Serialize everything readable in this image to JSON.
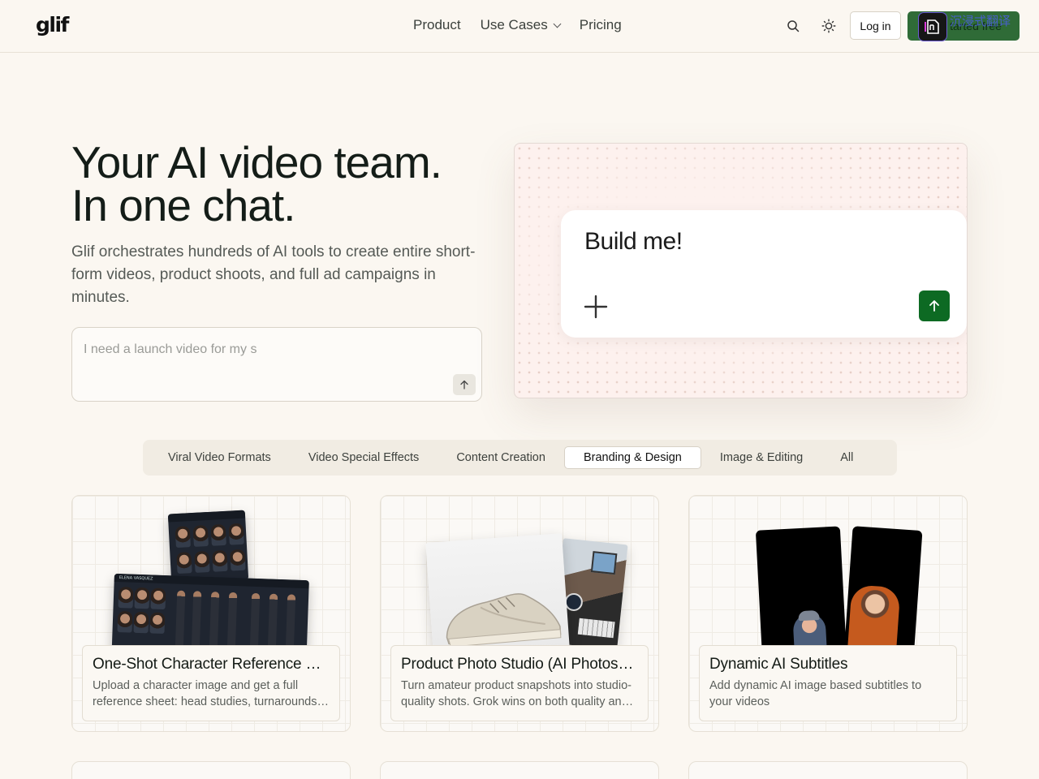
{
  "header": {
    "logo": "glif",
    "nav": [
      {
        "label": "Product"
      },
      {
        "label": "Use Cases",
        "has_dropdown": true
      },
      {
        "label": "Pricing"
      }
    ],
    "search_icon": "search-icon",
    "theme_icon": "sun-icon",
    "login_label": "Log in",
    "start_label": "tarted free",
    "overlay_text": "沉浸式翻译"
  },
  "hero": {
    "title_line1": "Your AI video team.",
    "title_line2": "In one chat.",
    "subtitle": "Glif orchestrates hundreds of AI tools to create entire short-form videos, product shoots, and full ad campaigns in minutes.",
    "prompt_placeholder": "I need a launch video for my s"
  },
  "demo": {
    "text": "Build me!"
  },
  "tabs": {
    "items": [
      {
        "label": "Viral Video Formats"
      },
      {
        "label": "Video Special Effects"
      },
      {
        "label": "Content Creation"
      },
      {
        "label": "Branding & Design",
        "active": true
      },
      {
        "label": "Image & Editing"
      },
      {
        "label": "All"
      }
    ]
  },
  "cards": [
    {
      "title": "One-Shot Character Reference Sheet",
      "description": "Upload a character image and get a full reference sheet: head studies, turnarounds and more.",
      "sheet_label": "ELENA VASQUEZ"
    },
    {
      "title": "Product Photo Studio (AI Photoshoot)",
      "description": "Turn amateur product snapshots into studio-quality shots. Grok wins on both quality and speed."
    },
    {
      "title": "Dynamic AI Subtitles",
      "description": "Add dynamic AI image based subtitles to your videos"
    }
  ],
  "colors": {
    "background": "#fbf7f1",
    "accent_green": "#0d6a23",
    "start_button": "#2f6b37"
  }
}
